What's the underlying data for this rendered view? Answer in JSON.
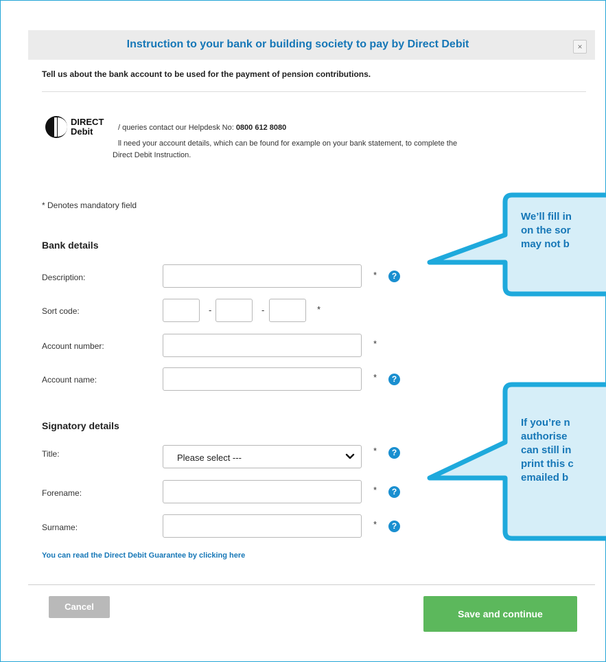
{
  "dialog": {
    "title": "Instruction to your bank or building society to pay by Direct Debit",
    "close_icon": "×",
    "intro": "Tell us about the bank account to be used for the payment of pension contributions."
  },
  "direct_debit": {
    "logo_line1": "DIRECT",
    "logo_line2": "Debit",
    "line1_prefix": "/ queries contact our Helpdesk No: ",
    "helpdesk_number": "0800 612 8080",
    "line2": "ll need your account details, which can be found for example on your bank statement, to complete the",
    "line3": "Direct Debit Instruction."
  },
  "mandatory_note": "* Denotes mandatory field",
  "bank_details": {
    "heading": "Bank details",
    "description_label": "Description:",
    "sort_code_label": "Sort code:",
    "sort_dash": "-",
    "account_number_label": "Account number:",
    "account_name_label": "Account name:"
  },
  "signatory_details": {
    "heading": "Signatory details",
    "title_label": "Title:",
    "title_value": "Please select ---",
    "forename_label": "Forename:",
    "surname_label": "Surname:"
  },
  "required_marker": "*",
  "help_icon_text": "?",
  "guarantee_link": "You can read the Direct Debit Guarantee by clicking here",
  "actions": {
    "cancel": "Cancel",
    "save": "Save and continue"
  },
  "callouts": {
    "top": [
      "We’ll fill in",
      "on the sor",
      "may not b"
    ],
    "bottom": [
      "If you’re n",
      "authorise",
      "can still in",
      "print this c",
      "emailed b"
    ]
  },
  "colors": {
    "brand_blue": "#1677b7",
    "callout_border": "#1ea9dc",
    "callout_fill": "#d6eef8",
    "save_green": "#5cb85c",
    "cancel_grey": "#b9b9b9"
  }
}
